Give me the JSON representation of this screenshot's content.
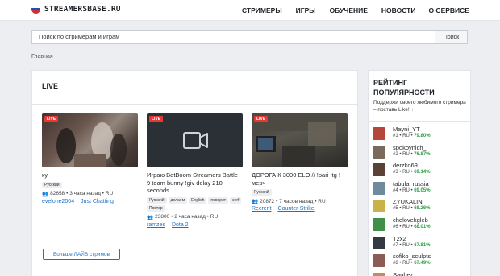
{
  "header": {
    "logo_text": "STREAMERSBASE.RU",
    "nav": [
      "СТРИМЕРЫ",
      "ИГРЫ",
      "ОБУЧЕНИЕ",
      "НОВОСТИ",
      "О СЕРВИСЕ"
    ]
  },
  "search": {
    "placeholder": "Поиск по стримерам и играм",
    "button": "Поиск"
  },
  "breadcrumb": "Главная",
  "live": {
    "heading": "LIVE",
    "badge": "LIVE",
    "streams": [
      {
        "title": "ку",
        "tags": [
          "Русский"
        ],
        "viewers": "82658",
        "meta": "• 3 часа назад • RU",
        "streamer": "evelone2004",
        "game": "Just Chatting"
      },
      {
        "title": "Играю BetBoom Streamers Battle 9 team bunny !giv delay 210 seconds",
        "tags": [
          "Русский",
          "делаем",
          "English",
          "поворот",
          "cerf",
          "Повтор"
        ],
        "viewers": "23800",
        "meta": "• 2 часа назад • RU",
        "streamer": "ramzes",
        "game": "Dota 2"
      },
      {
        "title": "ДОРОГА К 3000 ELO // !pari !tg ! мерч",
        "tags": [
          "Русский"
        ],
        "viewers": "20872",
        "meta": "• 7 часов назад • RU",
        "streamer": "Recrent",
        "game": "Counter-Strike"
      }
    ],
    "more_button": "Больше ЛАЙВ стримов"
  },
  "rating": {
    "title": "РЕЙТИНГ ПОПУЛЯРНОСТИ",
    "subtitle": "Поддержи своего любимого стримера – поставь Like!",
    "items": [
      {
        "name": "Mayni_YT",
        "rank": "#1 • RU •",
        "pct": "79.80%",
        "color": "#b5473a"
      },
      {
        "name": "spokoynich_",
        "rank": "#2 • RU •",
        "pct": "76.87%",
        "color": "#7a6a5e"
      },
      {
        "name": "derzko69",
        "rank": "#3 • RU •",
        "pct": "69.14%",
        "color": "#5a4336"
      },
      {
        "name": "tabula_russia",
        "rank": "#4 • RU •",
        "pct": "69.05%",
        "color": "#6e8a9c"
      },
      {
        "name": "ZYUKALIN",
        "rank": "#5 • RU •",
        "pct": "68.26%",
        "color": "#c9b24a"
      },
      {
        "name": "chelovekgleb",
        "rank": "#6 • RU •",
        "pct": "68.01%",
        "color": "#3f8f4a"
      },
      {
        "name": "T2x2",
        "rank": "#7 • RU •",
        "pct": "67.81%",
        "color": "#333a44"
      },
      {
        "name": "sofiko_sculpts",
        "rank": "#8 • RU •",
        "pct": "67.49%",
        "color": "#8a5c54"
      },
      {
        "name": "Sanhez__",
        "rank": "",
        "pct": "",
        "color": "#c28a66"
      }
    ]
  },
  "colors": {
    "accent": "#1a73c8",
    "live_red": "#e53935",
    "positive": "#2e9e44"
  }
}
